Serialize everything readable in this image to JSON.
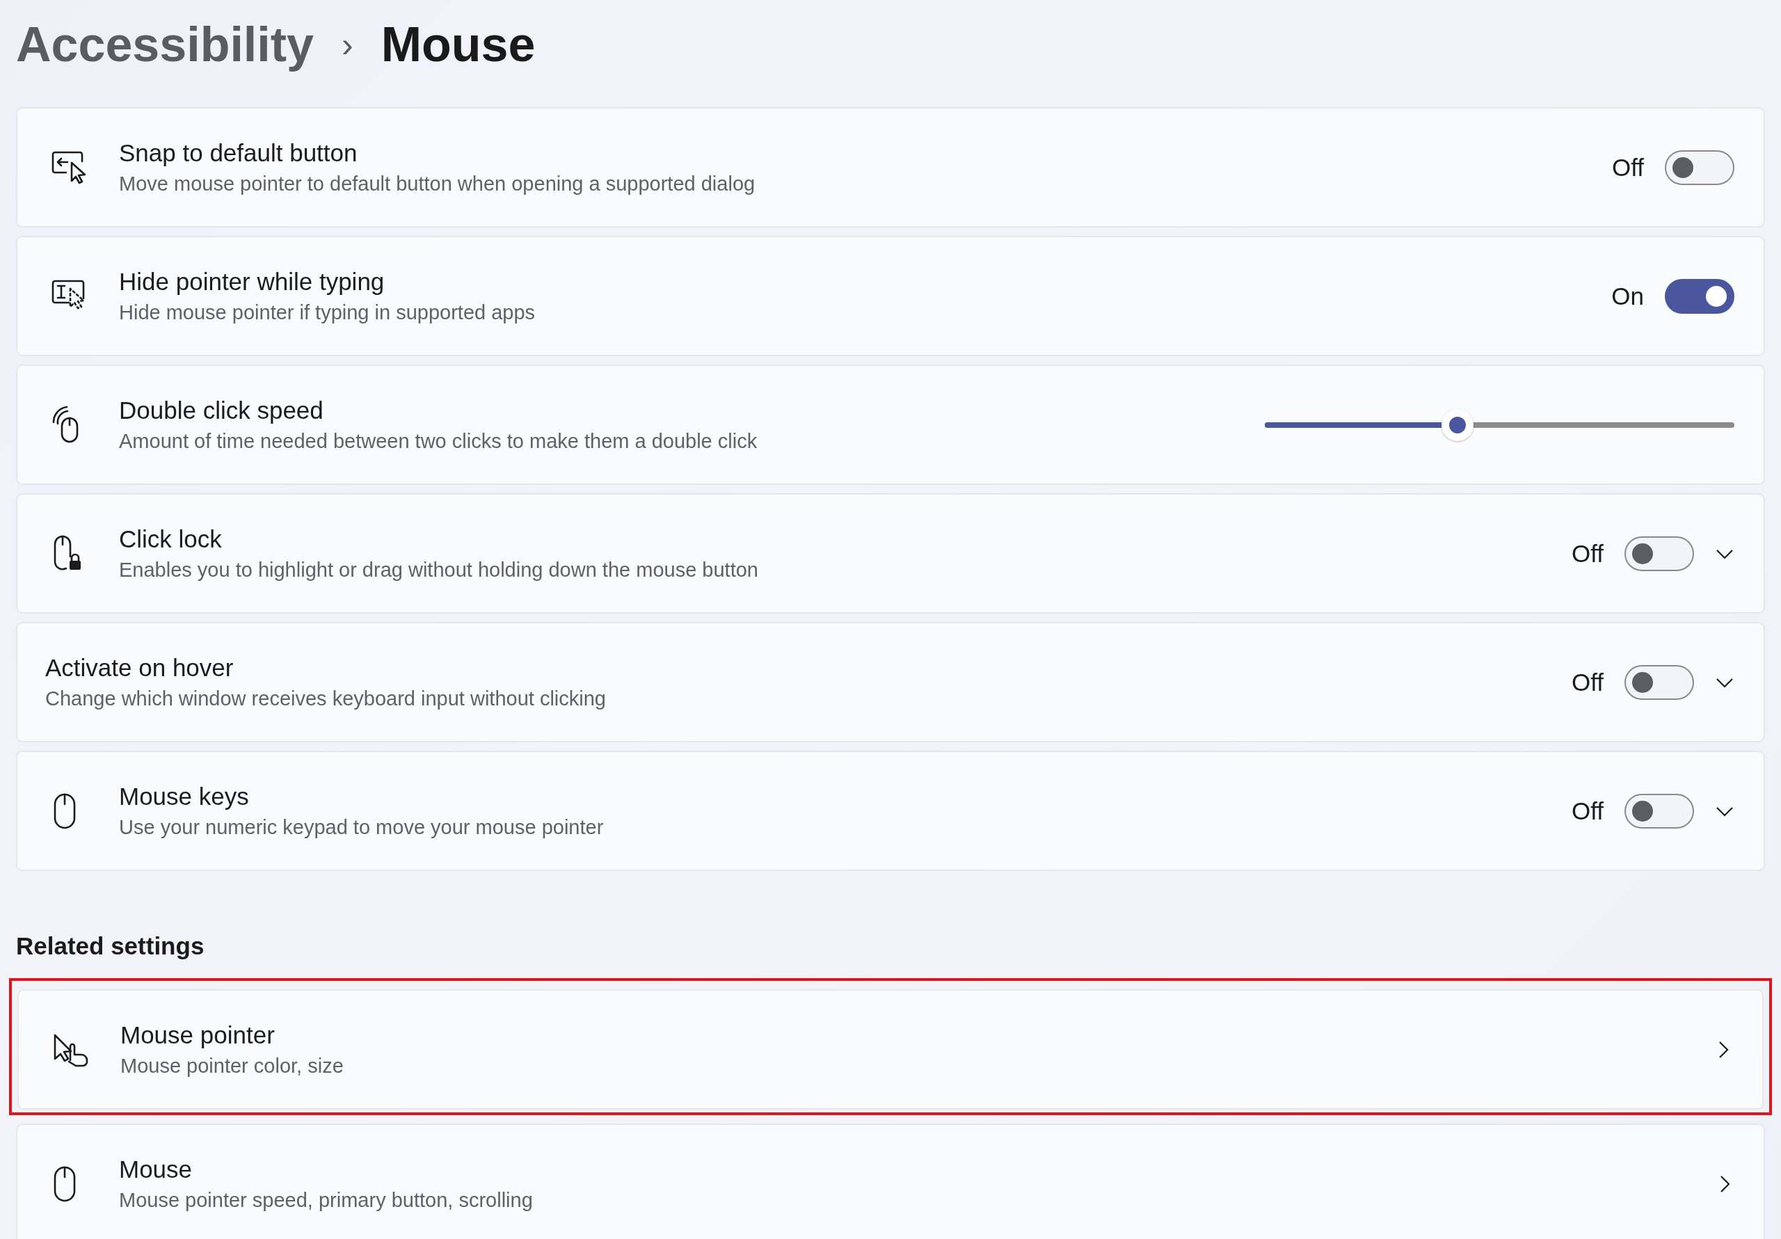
{
  "breadcrumb": {
    "parent": "Accessibility",
    "separator": "›",
    "current": "Mouse"
  },
  "settings": [
    {
      "kind": "toggle",
      "title": "Snap to default button",
      "description": "Move mouse pointer to default button when opening a supported dialog",
      "state_label": "Off",
      "on": false,
      "expandable": false
    },
    {
      "kind": "toggle",
      "title": "Hide pointer while typing",
      "description": "Hide mouse pointer if typing in supported apps",
      "state_label": "On",
      "on": true,
      "expandable": false
    },
    {
      "kind": "slider",
      "title": "Double click speed",
      "description": "Amount of time needed between two clicks to make them a double click",
      "level": 0.41
    },
    {
      "kind": "toggle",
      "title": "Click lock",
      "description": "Enables you to highlight or drag without holding down the mouse button",
      "state_label": "Off",
      "on": false,
      "expandable": true
    },
    {
      "kind": "toggle",
      "title": "Activate on hover",
      "description": "Change which window receives keyboard input without clicking",
      "state_label": "Off",
      "on": false,
      "expandable": true
    },
    {
      "kind": "toggle",
      "title": "Mouse keys",
      "description": "Use your numeric keypad to move your mouse pointer",
      "state_label": "Off",
      "on": false,
      "expandable": true
    }
  ],
  "related_settings": {
    "heading": "Related settings",
    "items": [
      {
        "title": "Mouse pointer",
        "description": "Mouse pointer color, size",
        "highlighted": true
      },
      {
        "title": "Mouse",
        "description": "Mouse pointer speed, primary button, scrolling",
        "highlighted": false
      }
    ]
  }
}
